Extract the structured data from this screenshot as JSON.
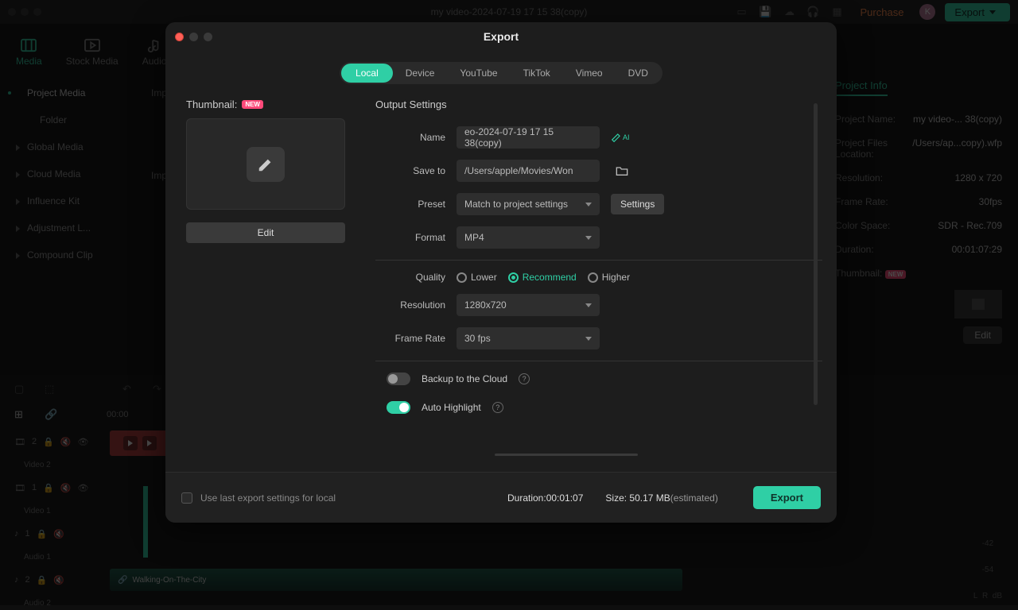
{
  "titlebar": {
    "title": "my video-2024-07-19 17 15 38(copy)",
    "purchase": "Purchase",
    "avatar_initial": "K",
    "export": "Export"
  },
  "nav": {
    "media": "Media",
    "stock": "Stock Media",
    "audio": "Audio"
  },
  "sidebar": {
    "project_media": "Project Media",
    "folder": "Folder",
    "global_media": "Global Media",
    "cloud_media": "Cloud Media",
    "influence": "Influence Kit",
    "adjustment": "Adjustment L...",
    "compound": "Compound Clip"
  },
  "main": {
    "imp1": "Imp...",
    "imp2": "Imp..."
  },
  "project_info": {
    "title": "Project Info",
    "name_lbl": "Project Name:",
    "name_val": "my video-... 38(copy)",
    "files_lbl": "Project Files Location:",
    "files_val": "/Users/ap...copy).wfp",
    "res_lbl": "Resolution:",
    "res_val": "1280 x 720",
    "fr_lbl": "Frame Rate:",
    "fr_val": "30fps",
    "cs_lbl": "Color Space:",
    "cs_val": "SDR - Rec.709",
    "dur_lbl": "Duration:",
    "dur_val": "00:01:07:29",
    "thumb_lbl": "Thumbnail:",
    "edit": "Edit"
  },
  "timeline": {
    "time": "00:00",
    "video2_idx": "2",
    "video2": "Video 2",
    "video1_idx": "1",
    "video1": "Video 1",
    "audio1_idx": "1",
    "audio1": "Audio 1",
    "audio2_idx": "2",
    "audio2": "Audio 2",
    "clip_name": "Walking-On-The-City",
    "db42": "-42",
    "db54": "-54",
    "dB": "dB",
    "L": "L",
    "R": "R"
  },
  "modal": {
    "title": "Export",
    "tabs": {
      "local": "Local",
      "device": "Device",
      "youtube": "YouTube",
      "tiktok": "TikTok",
      "vimeo": "Vimeo",
      "dvd": "DVD"
    },
    "thumbnail_label": "Thumbnail:",
    "new_badge": "NEW",
    "edit_btn": "Edit",
    "output_settings": "Output Settings",
    "name_lbl": "Name",
    "name_val": "eo-2024-07-19 17 15 38(copy)",
    "ai": "AI",
    "save_lbl": "Save to",
    "save_val": "/Users/apple/Movies/Won",
    "preset_lbl": "Preset",
    "preset_val": "Match to project settings",
    "settings_btn": "Settings",
    "format_lbl": "Format",
    "format_val": "MP4",
    "quality_lbl": "Quality",
    "q_lower": "Lower",
    "q_rec": "Recommend",
    "q_higher": "Higher",
    "res_lbl": "Resolution",
    "res_val": "1280x720",
    "fr_lbl": "Frame Rate",
    "fr_val": "30 fps",
    "backup_lbl": "Backup to the Cloud",
    "autohl_lbl": "Auto Highlight",
    "footer": {
      "use_last": "Use last export settings for local",
      "duration_lbl": "Duration:",
      "duration_val": "00:01:07",
      "size_lbl": "Size: ",
      "size_val": "50.17 MB",
      "size_est": "(estimated)",
      "export": "Export"
    }
  }
}
